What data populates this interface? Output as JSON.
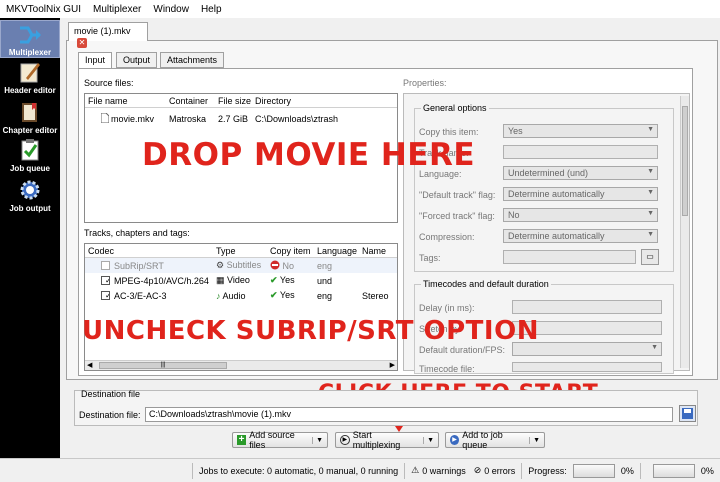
{
  "menubar": {
    "items": [
      "MKVToolNix GUI",
      "Multiplexer",
      "Window",
      "Help"
    ]
  },
  "sidebar": {
    "items": [
      {
        "label": "Multiplexer",
        "icon": "multiplexer-icon"
      },
      {
        "label": "Header editor",
        "icon": "pen-icon"
      },
      {
        "label": "Chapter editor",
        "icon": "book-icon"
      },
      {
        "label": "Job queue",
        "icon": "clipboard-check-icon"
      },
      {
        "label": "Job output",
        "icon": "gear-icon"
      }
    ]
  },
  "file_tab": {
    "label": "movie (1).mkv",
    "close": "✕"
  },
  "subtabs": [
    "Input",
    "Output",
    "Attachments"
  ],
  "source_files": {
    "heading": "Source files:",
    "columns": [
      "File name",
      "Container",
      "File size",
      "Directory"
    ],
    "rows": [
      {
        "name": "movie.mkv",
        "container": "Matroska",
        "size": "2.7 GiB",
        "directory": "C:\\Downloads\\ztrash"
      }
    ]
  },
  "tracks": {
    "heading": "Tracks, chapters and tags:",
    "columns": [
      "Codec",
      "Type",
      "Copy item",
      "Language",
      "Name"
    ],
    "rows": [
      {
        "checked": false,
        "codec": "SubRip/SRT",
        "type": "Subtitles",
        "copy": "No",
        "lang": "eng",
        "name": ""
      },
      {
        "checked": true,
        "codec": "MPEG-4p10/AVC/h.264",
        "type": "Video",
        "copy": "Yes",
        "lang": "und",
        "name": ""
      },
      {
        "checked": true,
        "codec": "AC-3/E-AC-3",
        "type": "Audio",
        "copy": "Yes",
        "lang": "eng",
        "name": "Stereo"
      }
    ],
    "scroll_glyph": "|||"
  },
  "properties": {
    "heading": "Properties:",
    "general": {
      "title": "General options",
      "rows": [
        {
          "label": "Copy this item:",
          "value": "Yes",
          "kind": "combo"
        },
        {
          "label": "Track name:",
          "value": "",
          "kind": "field"
        },
        {
          "label": "Language:",
          "value": "Undetermined (und)",
          "kind": "combo"
        },
        {
          "label": "\"Default track\" flag:",
          "value": "Determine automatically",
          "kind": "combo"
        },
        {
          "label": "\"Forced track\" flag:",
          "value": "No",
          "kind": "combo"
        },
        {
          "label": "Compression:",
          "value": "Determine automatically",
          "kind": "combo"
        },
        {
          "label": "Tags:",
          "value": "",
          "kind": "field"
        }
      ]
    },
    "timecodes": {
      "title": "Timecodes and default duration",
      "rows": [
        {
          "label": "Delay (in ms):"
        },
        {
          "label": "Stretch by:"
        },
        {
          "label": "Default duration/FPS:"
        },
        {
          "label": "Timecode file:"
        }
      ]
    }
  },
  "overlays": {
    "drop": "DROP MOVIE HERE",
    "uncheck": "UNCHECK SUBRIP/SRT OPTION",
    "start": "CLICK HERE TO START"
  },
  "destination": {
    "group_title": "Destination file",
    "label": "Destination file:",
    "value": "C:\\Downloads\\ztrash\\movie (1).mkv"
  },
  "buttons": {
    "add_source": "Add source files",
    "start": "Start multiplexing",
    "add_queue": "Add to job queue"
  },
  "statusbar": {
    "jobs": "Jobs to execute:  0 automatic, 0 manual, 0 running",
    "warnings": "0 warnings",
    "errors": "0 errors",
    "progress_label": "Progress:",
    "progress1": "0%",
    "progress2": "0%"
  },
  "colors": {
    "overlay": "#e0241c",
    "sidebar_bg": "#000000",
    "active_item": "#6a7fb0"
  }
}
